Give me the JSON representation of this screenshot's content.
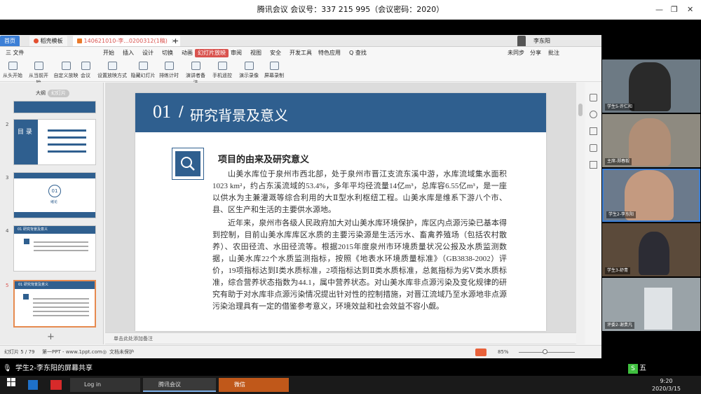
{
  "meeting": {
    "title": "腾讯会议 会议号：337 215 995（会议密码：2020）"
  },
  "window_controls": {
    "minimize": "—",
    "restore": "❐",
    "close": "✕"
  },
  "wps": {
    "tabs": [
      {
        "label": "首页"
      },
      {
        "label": "稻壳模板"
      },
      {
        "label": "140621010-李...0200312(1稿)"
      },
      {
        "label": "+"
      }
    ],
    "menus": [
      "三 文件",
      "开始",
      "插入",
      "设计",
      "切换",
      "动画",
      "幻灯片放映",
      "审阅",
      "视图",
      "安全",
      "开发工具",
      "特色应用",
      "Q 查找"
    ],
    "right_menu": [
      "未同步",
      "分享",
      "批注"
    ],
    "user_name": "李东阳",
    "ribbon_buttons": [
      "从头开始",
      "从当前开始",
      "自定义放映",
      "会议",
      "设置放映方式",
      "隐藏幻灯片",
      "排练计时",
      "演讲者备注",
      "手机遥控",
      "演示录像",
      "屏幕录制"
    ],
    "panel_tabs": [
      "大纲",
      "幻灯片"
    ],
    "thumbnails": {
      "t2_title": "目 录",
      "t3_circle": "01",
      "t3_label": "绪论",
      "t4_title": "01 研究背景及意义",
      "t5_title": "01 研究背景及意义",
      "add": "+"
    },
    "slide": {
      "number": "01",
      "heading": "研究背景及意义",
      "subheading": "项目的由来及研究意义",
      "para1": "山美水库位于泉州市西北部，处于泉州市晋江支流东溪中游，水库流域集水面积1023 km²，约占东溪流域的53.4%，多年平均径流量14亿m³，总库容6.55亿m³，是一座以供水为主兼灌溉等综合利用的大Ⅱ型水利枢纽工程。山美水库是维系下游八个市、县、区生产和生活的主要供水源地。",
      "para2": "近年来，泉州市各级人民政府加大对山美水库环境保护，库区内点源污染已基本得到控制，目前山美水库库区水质的主要污染源是生活污水、畜禽养殖场（包括农村散养）、农田径流、水田径流等。根据2015年度泉州市环境质量状况公报及水质监测数据，山美水库22个水质监测指标，按照《地表水环境质量标准》（GB3838-2002）评价，19项指标达到Ⅰ类水质标准，2项指标达到Ⅱ类水质标准，总氮指标为劣Ⅴ类水质标准，综合营养状态指数为44.1，属中营养状态。对山美水库非点源污染及变化规律的研究有助于对水库非点源污染情况提出针对性的控制措施，对晋江流域乃至水源地非点源污染治理具有一定的借鉴参考意义，环境效益和社会效益不容小觑。"
    },
    "notes_placeholder": "单击此处添加备注",
    "status": {
      "slide_info": "幻灯片 5 / 79",
      "theme": "第一PPT - www.1ppt.com",
      "protect": "文档未保护",
      "zoom": "85%"
    }
  },
  "participants": [
    {
      "name": "学生5-许仁和"
    },
    {
      "name": "主席-郑春毅"
    },
    {
      "name": "学生2-李东阳"
    },
    {
      "name": "学生3-舒青"
    },
    {
      "name": "评委2-谢贵凡"
    }
  ],
  "sharing_text": "学生2-李东阳的屏幕共享",
  "taskbar": {
    "apps": [
      "Log in",
      "腾讯会议",
      "微信"
    ],
    "ime": "五",
    "time": "9:20",
    "date": "2020/3/15"
  }
}
